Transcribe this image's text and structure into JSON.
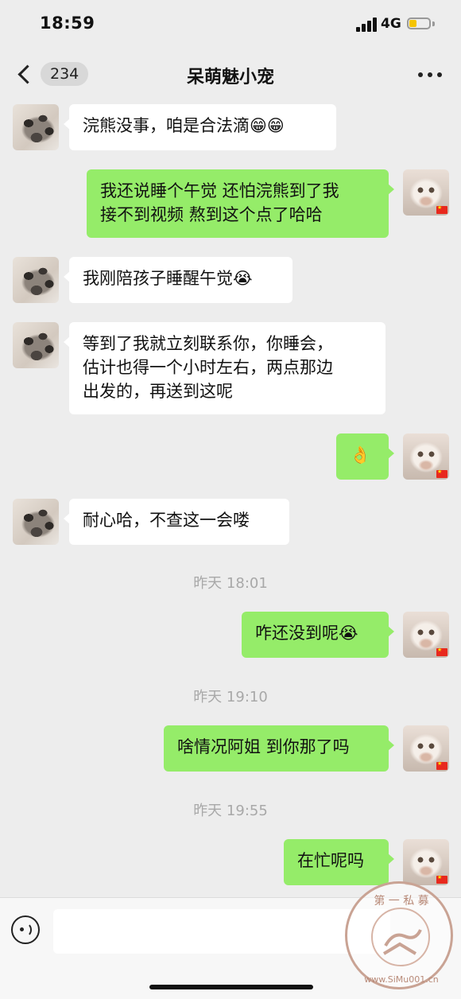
{
  "status_bar": {
    "time": "18:59",
    "network": "4G"
  },
  "nav": {
    "unread_count": "234",
    "title": "呆萌魅小宠"
  },
  "messages": [
    {
      "text": "浣熊没事，咱是合法滴😁😁"
    },
    {
      "text": "我还说睡个午觉 还怕浣熊到了我\n接不到视频 熬到这个点了哈哈"
    },
    {
      "text": "我刚陪孩子睡醒午觉😭"
    },
    {
      "text": "等到了我就立刻联系你，你睡会，\n估计也得一个小时左右，两点那边\n出发的，再送到这呢"
    },
    {
      "text": "👌"
    },
    {
      "text": "耐心哈，不查这一会喽"
    },
    {
      "text": "咋还没到呢😭"
    },
    {
      "text": "啥情况阿姐 到你那了吗"
    },
    {
      "text": "在忙呢吗"
    }
  ],
  "timestamps": [
    "昨天 18:01",
    "昨天 19:10",
    "昨天 19:55"
  ],
  "input": {
    "placeholder": ""
  },
  "watermark": {
    "text": "第一私募 www.SiMu001.cn"
  },
  "colors": {
    "sent_bubble": "#95ec69",
    "received_bubble": "#ffffff",
    "background": "#ededed"
  },
  "icons": [
    "back-chevron-icon",
    "more-dots-icon",
    "voice-icon",
    "signal-icon",
    "battery-icon"
  ]
}
